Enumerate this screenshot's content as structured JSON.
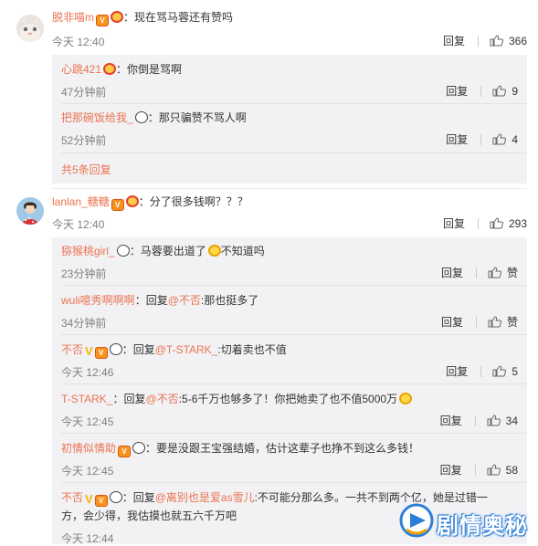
{
  "comments": [
    {
      "user": "脱非喵m",
      "text": "现在骂马蓉还有赞吗",
      "time": "今天 12:40",
      "reply_label": "回复",
      "likes": "366",
      "replies": [
        {
          "user": "心跳421",
          "text": "你倒是骂啊",
          "time": "47分钟前",
          "reply_label": "回复",
          "likes": "9"
        },
        {
          "user": "把那碗饭给我_",
          "text": "那只骗赞不骂人啊",
          "time": "52分钟前",
          "reply_label": "回复",
          "likes": "4"
        }
      ],
      "more_label": "共5条回复"
    },
    {
      "user": "lanlan_糖糖",
      "text": "分了很多钱啊？？？",
      "time": "今天 12:40",
      "reply_label": "回复",
      "likes": "293",
      "replies": [
        {
          "user": "猕猴桃girl_",
          "text": "马蓉要出道了",
          "text2": "不知道吗",
          "time": "23分钟前",
          "reply_label": "回复",
          "likes": "赞"
        },
        {
          "user": "wuli噫秀啊啊啊",
          "text": "回复",
          "mention": "@不否",
          "text2": ":那也挺多了",
          "time": "34分钟前",
          "reply_label": "回复",
          "likes": "赞"
        },
        {
          "user": "不否",
          "text": "回复",
          "mention": "@T-STARK_",
          "text2": ":切着卖也不值",
          "time": "今天 12:46",
          "reply_label": "回复",
          "likes": "5"
        },
        {
          "user": "T-STARK_",
          "text": "回复",
          "mention": "@不否",
          "text2": ":5-6千万也够多了！你把她卖了也不值5000万",
          "time": "今天 12:45",
          "reply_label": "回复",
          "likes": "34"
        },
        {
          "user": "初情似情助",
          "text": "要是没跟王宝强结婚，估计这辈子也挣不到这么多钱！",
          "time": "今天 12:45",
          "reply_label": "回复",
          "likes": "58"
        },
        {
          "user": "不否",
          "text": "回复",
          "mention": "@离别也是爱as雪儿",
          "text2": ":不可能分那么多。一共不到两个亿，她是过错一",
          "text3": "方，会少得，我估摸也就五六千万吧",
          "time": "今天 12:44",
          "reply_label": "回复",
          "likes": ""
        }
      ]
    }
  ],
  "watermark": {
    "text": "剧情奥秘"
  },
  "colors": {
    "username": "#eb7350",
    "reply_bg": "#f2f2f5",
    "time": "#808080"
  }
}
